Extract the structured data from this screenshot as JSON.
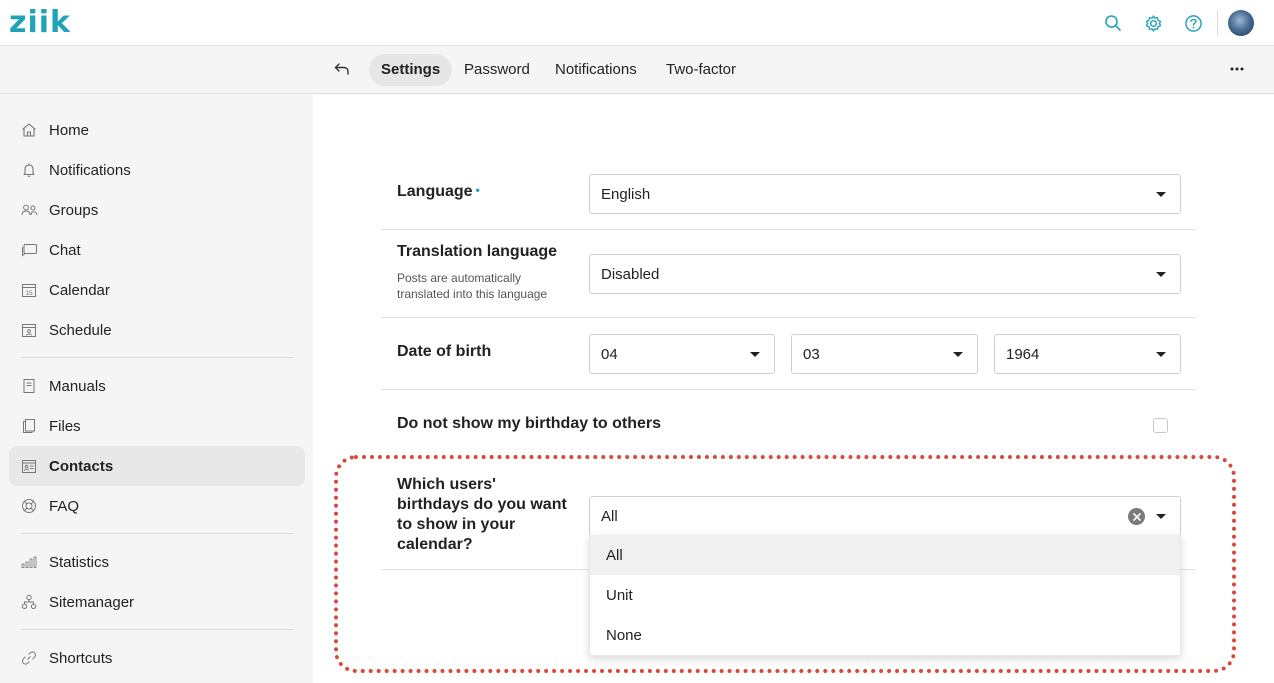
{
  "app": {
    "logo_text": "ziik",
    "accent": "#1fa3b8"
  },
  "header_icons": [
    "search-icon",
    "gear-icon",
    "help-icon",
    "avatar"
  ],
  "tabs": [
    {
      "label": "Settings",
      "active": true
    },
    {
      "label": "Password",
      "active": false
    },
    {
      "label": "Notifications",
      "active": false
    },
    {
      "label": "Two-factor",
      "active": false
    }
  ],
  "sidebar": {
    "items": [
      {
        "label": "Home",
        "icon": "home-icon"
      },
      {
        "label": "Notifications",
        "icon": "bell-icon"
      },
      {
        "label": "Groups",
        "icon": "users-icon"
      },
      {
        "label": "Chat",
        "icon": "chat-icon"
      },
      {
        "label": "Calendar",
        "icon": "calendar-icon",
        "icon_text": "15"
      },
      {
        "label": "Schedule",
        "icon": "schedule-icon"
      },
      {
        "label": "Manuals",
        "icon": "manual-icon"
      },
      {
        "label": "Files",
        "icon": "files-icon"
      },
      {
        "label": "Contacts",
        "icon": "contacts-icon",
        "active": true
      },
      {
        "label": "FAQ",
        "icon": "lifebuoy-icon"
      },
      {
        "label": "Statistics",
        "icon": "statistics-icon"
      },
      {
        "label": "Sitemanager",
        "icon": "sitemap-icon"
      },
      {
        "label": "Shortcuts",
        "icon": "link-icon"
      }
    ]
  },
  "form": {
    "language": {
      "label": "Language",
      "value": "English",
      "required": true
    },
    "translation": {
      "label": "Translation language",
      "sub_line1": "Posts are automatically",
      "sub_line2": "translated into this language",
      "value": "Disabled"
    },
    "dob": {
      "label": "Date of birth",
      "day": "04",
      "month": "03",
      "year": "1964"
    },
    "hide_birthday": {
      "label": "Do not show my birthday to others",
      "checked": false
    },
    "birthdays": {
      "label_lines": [
        "Which users'",
        "birthdays do you want",
        "to show in your",
        "calendar?"
      ],
      "value": "All",
      "options": [
        "All",
        "Unit",
        "None"
      ],
      "highlighted": "All"
    }
  },
  "annotation": {
    "color": "#d9493a"
  }
}
